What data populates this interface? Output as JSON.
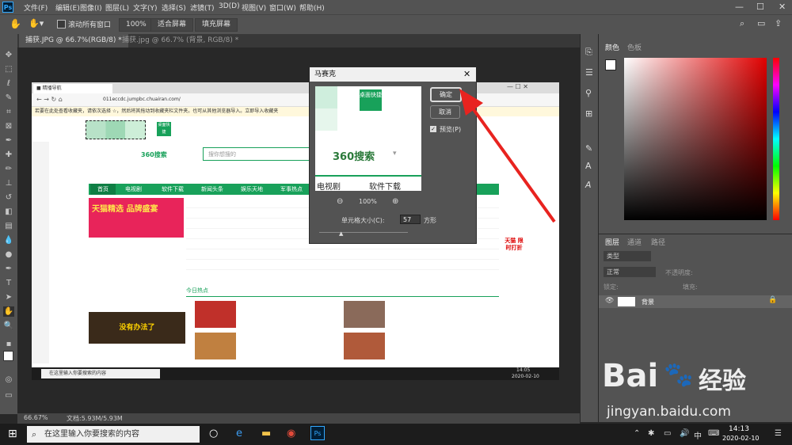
{
  "app": {
    "logo": "Ps",
    "menu": [
      "文件(F)",
      "编辑(E)",
      "图像(I)",
      "图层(L)",
      "文字(Y)",
      "选择(S)",
      "滤镜(T)",
      "3D(D)",
      "视图(V)",
      "窗口(W)",
      "帮助(H)"
    ],
    "window_controls": {
      "min": "—",
      "max": "☐",
      "close": "✕"
    }
  },
  "options_bar": {
    "scroll_all_label": "滚动所有窗口",
    "zoom": "100%",
    "fit_screen": "适合屏幕",
    "fill_screen": "填充屏幕"
  },
  "tabs": [
    {
      "label": "捕获.JPG @ 66.7%(RGB/8) *"
    },
    {
      "label": "捕获.jpg @ 66.7% (背景, RGB/8) *"
    }
  ],
  "status": {
    "zoom": "66.67%",
    "doc": "文档:5.93M/5.93M"
  },
  "panels": {
    "color_tabs": [
      "颜色",
      "色板"
    ],
    "layers_tabs": [
      "图层",
      "通道",
      "路径"
    ],
    "layer_filter": "类型",
    "blend_mode": "正常",
    "opacity_label": "不透明度:",
    "lock_label": "锁定:",
    "fill_label": "填充:",
    "layer_name": "背景"
  },
  "dialog": {
    "title": "马赛克",
    "ok": "确定",
    "cancel": "取消",
    "preview_label": "预览(P)",
    "zoom": "100%",
    "cell_size_label": "单元格大小(C):",
    "cell_size_value": "57",
    "cell_unit": "方形",
    "preview_texts": {
      "badge": "桌面快捷",
      "brand": "360搜索",
      "nav1": "电视剧",
      "nav2": "软件下载"
    }
  },
  "screenshot_content": {
    "address": "011eccdc.jumpbc.chuairan.com/",
    "notice": "若要在此处查看收藏夹，请依次选择 ☆，然后将其拖动到收藏夹栏文件夹。也可从其他浏览器导入。立即导入收藏夹",
    "search_placeholder": "搜你想搜的",
    "search_brand": "360搜索",
    "nav": [
      "首页",
      "电视剧",
      "软件下载",
      "新闻头条",
      "娱乐天地",
      "军事热点"
    ],
    "banner": "天猫精选 品牌盛宴",
    "news_headline": "今日热点",
    "tmall": "天猫 限时打折",
    "clock": "14:05",
    "date": "2020-02-10",
    "taskbar_search": "在这里输入你要搜索的内容"
  },
  "taskbar": {
    "search": "在这里输入你要搜索的内容",
    "time": "14:13",
    "date": "2020-02-10",
    "ime": "中"
  },
  "watermark": {
    "brand": "Bai",
    "suffix": "经验",
    "url": "jingyan.baidu.com"
  },
  "colors": {
    "accent": "#31a8ff",
    "arrow": "#e8231f",
    "green": "#18a15a"
  }
}
